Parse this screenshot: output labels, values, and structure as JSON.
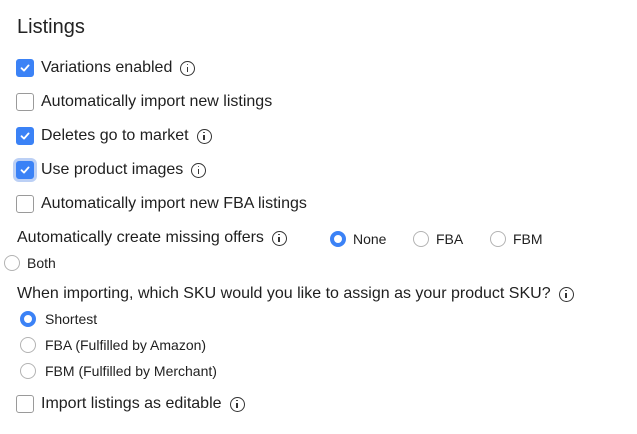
{
  "section_title": "Listings",
  "checkboxes": [
    {
      "label": "Variations enabled",
      "checked": true
    },
    {
      "label": "Automatically import new listings",
      "checked": false
    },
    {
      "label": "Deletes go to market",
      "checked": true
    },
    {
      "label": "Use product images",
      "checked": true
    },
    {
      "label": "Automatically import new FBA listings",
      "checked": false
    }
  ],
  "missing_offers": {
    "label": "Automatically create missing offers",
    "options": [
      "None",
      "FBA",
      "FBM",
      "Both"
    ],
    "selected": "None"
  },
  "sku_assign": {
    "question": "When importing, which SKU would you like to assign as your product SKU?",
    "options": [
      "Shortest",
      "FBA (Fulfilled by Amazon)",
      "FBM (Fulfilled by Merchant)"
    ],
    "selected": "Shortest"
  },
  "editable": {
    "label": "Import listings as editable",
    "checked": false
  },
  "colors": {
    "accent": "#3b82f6",
    "focus_ring": "#bcd0f5"
  }
}
